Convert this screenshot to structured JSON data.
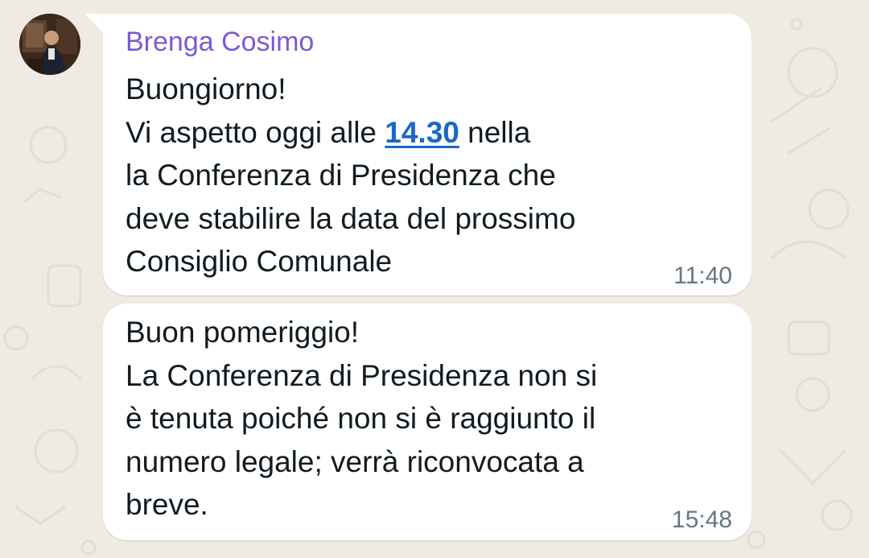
{
  "chat": {
    "sender_name": "Brenga Cosimo",
    "colors": {
      "background": "#efeae2",
      "bubble": "#ffffff",
      "sender_name": "#7b5ad6",
      "link": "#1769c9",
      "timestamp": "#667781",
      "text": "#111b21"
    },
    "messages": [
      {
        "line1": "Buongiorno!",
        "line2_before": "Vi aspetto oggi alle ",
        "line2_link": "14.30",
        "line2_after": " nella",
        "line3": "la Conferenza di Presidenza che",
        "line4": "deve stabilire la data del prossimo",
        "line5": "Consiglio Comunale",
        "time": "11:40"
      },
      {
        "line1": "Buon pomeriggio!",
        "line2": "La Conferenza di Presidenza non si",
        "line3": "è tenuta poiché non si è raggiunto il",
        "line4": "numero legale; verrà riconvocata a",
        "line5": "breve.",
        "time": "15:48"
      }
    ]
  }
}
